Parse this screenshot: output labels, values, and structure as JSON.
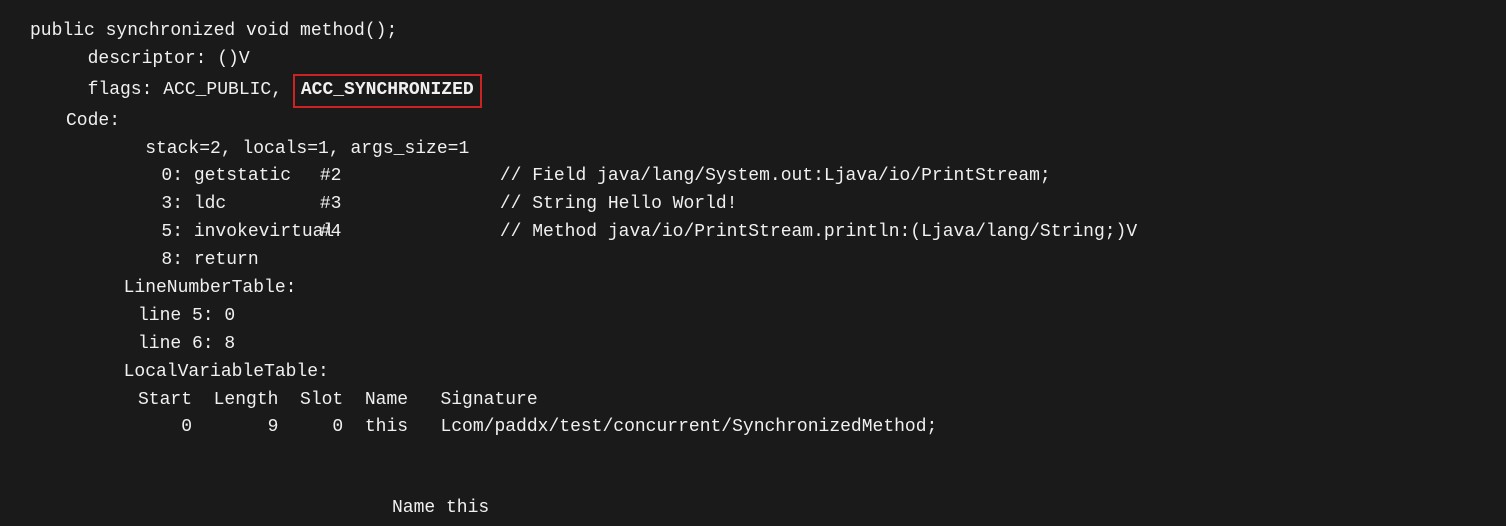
{
  "code": {
    "line1": "public synchronized void method();",
    "line2_label": "  descriptor: ()V",
    "line3_prefix": "  flags: ACC_PUBLIC, ",
    "line3_highlight": "ACC_SYNCHRONIZED",
    "line4": "  Code:",
    "line5": "    stack=2, locals=1, args_size=1",
    "bytecodes": [
      {
        "num": "0:",
        "op": "getstatic",
        "ref": "#2",
        "comment": "// Field java/lang/System.out:Ljava/io/PrintStream;"
      },
      {
        "num": "3:",
        "op": "ldc",
        "ref": "#3",
        "comment": "// String Hello World!"
      },
      {
        "num": "5:",
        "op": "invokevirtual",
        "ref": "#4",
        "comment": "// Method java/io/PrintStream.println:(Ljava/lang/String;)V"
      },
      {
        "num": "8:",
        "op": "return",
        "ref": "",
        "comment": ""
      }
    ],
    "line_number_table": "  LineNumberTable:",
    "ln_entries": [
      "    line 5: 0",
      "    line 6: 8"
    ],
    "local_variable_table": "  LocalVariableTable:",
    "lv_header": "    Start  Length  Slot  Name   Signature",
    "lv_entry": "        0       9     0  this   Lcom/paddx/test/concurrent/SynchronizedMethod;",
    "bottom_label": "Name this"
  }
}
